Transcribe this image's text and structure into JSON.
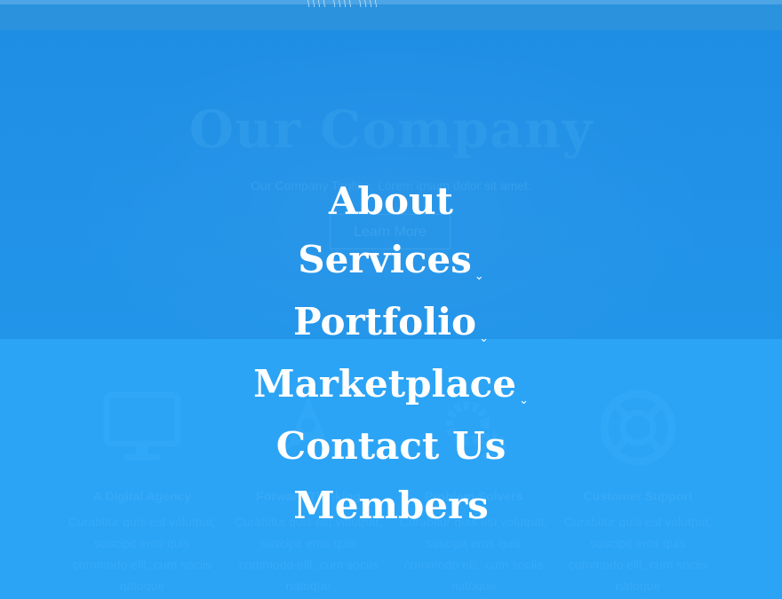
{
  "header": {
    "logo_text": "\\\\\\\\ \\\\\\\\ \\\\\\\\"
  },
  "hero": {
    "title": "Our Company",
    "subtitle": "Our Company Tagline. Lorem ipsum dolor sit amet.",
    "button_label": "Learn More"
  },
  "features": [
    {
      "title": "A Digital Agency",
      "icon": "monitor-icon",
      "text": "Curabitur quis est volutpat, suscipit eros quis commodo elit, cum sociis natoque"
    },
    {
      "title": "Forward Thinking",
      "icon": "rocket-icon",
      "text": "Curabitur quis est volutpat, suscipit eros quis commodo elit, cum sociis natoque"
    },
    {
      "title": "Problem Solvers",
      "icon": "gears-icon",
      "text": "Curabitur quis est volutpat, suscipit eros quis commodo elit, cum sociis natoque"
    },
    {
      "title": "Customer Support",
      "icon": "lifebuoy-icon",
      "text": "Curabitur quis est volutpat, suscipit eros quis commodo elit, cum sociis natoque"
    }
  ],
  "menu": {
    "items": [
      {
        "label": "About",
        "has_submenu": false
      },
      {
        "label": "Services",
        "has_submenu": true
      },
      {
        "label": "Portfolio",
        "has_submenu": true
      },
      {
        "label": "Marketplace",
        "has_submenu": true
      },
      {
        "label": "Contact Us",
        "has_submenu": false
      },
      {
        "label": "Members",
        "has_submenu": false
      }
    ],
    "submenu_glyph": "⌄"
  },
  "colors": {
    "overlay": "#24a0f5",
    "menu_text": "#ffffff",
    "hero_bg": "#1d89e0"
  }
}
